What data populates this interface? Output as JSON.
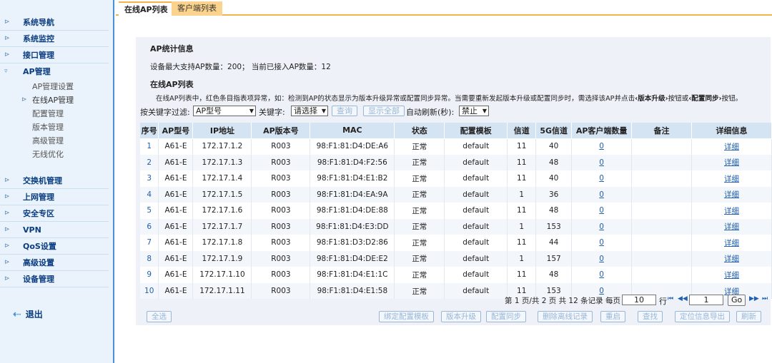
{
  "sidebar": {
    "sections_top": [
      {
        "label": "系统导航"
      },
      {
        "label": "系统监控"
      },
      {
        "label": "接口管理"
      }
    ],
    "ap_section": {
      "label": "AP管理"
    },
    "ap_subitems": [
      {
        "label": "AP管理设置"
      },
      {
        "label": "在线AP管理"
      },
      {
        "label": "配置管理"
      },
      {
        "label": "版本管理"
      },
      {
        "label": "高级管理"
      },
      {
        "label": "无线优化"
      }
    ],
    "sections_bottom": [
      {
        "label": "交换机管理"
      },
      {
        "label": "上网管理"
      },
      {
        "label": "安全专区"
      },
      {
        "label": "VPN"
      },
      {
        "label": "QoS设置"
      },
      {
        "label": "高级设置"
      },
      {
        "label": "设备管理"
      }
    ],
    "logout": "退出"
  },
  "tabs": {
    "online_ap": "在线AP列表",
    "client": "客户端列表"
  },
  "stats": {
    "title": "AP统计信息",
    "text": "设备最大支持AP数量：200； 当前已接入AP数量：12"
  },
  "list": {
    "title": "在线AP列表",
    "note_prefix": "在线AP列表中，红色条目指表项异常，如：检测到AP的状态显示为版本升级异常或配置同步异常。当需要重新发起版本升级或配置同步时，需选择该AP并点击",
    "note_upgrade": "‹版本升级›",
    "note_mid": "按钮或",
    "note_sync": "‹配置同步›",
    "note_suffix": "按钮。"
  },
  "filter": {
    "label": "按关键字过滤:",
    "field_value": "AP型号",
    "keyword_label": "关键字:",
    "keyword_value": "请选择",
    "query_btn": "查询",
    "show_all_btn": "显示全部",
    "auto_refresh_label": "自动刷新(秒):",
    "auto_refresh_value": "禁止"
  },
  "table": {
    "headers": [
      "序号",
      "AP型号",
      "IP地址",
      "AP版本号",
      "MAC",
      "状态",
      "配置模板",
      "信道",
      "5G信道",
      "AP客户端数量",
      "备注",
      "详细信息"
    ],
    "rows": [
      [
        "1",
        "A61-E",
        "172.17.1.2",
        "R003",
        "98:F1:81:D4:DE:A6",
        "正常",
        "default",
        "11",
        "40",
        "0",
        "",
        "详细"
      ],
      [
        "2",
        "A61-E",
        "172.17.1.3",
        "R003",
        "98:F1:81:D4:F2:56",
        "正常",
        "default",
        "11",
        "48",
        "0",
        "",
        "详细"
      ],
      [
        "3",
        "A61-E",
        "172.17.1.4",
        "R003",
        "98:F1:81:D4:E1:B2",
        "正常",
        "default",
        "11",
        "40",
        "0",
        "",
        "详细"
      ],
      [
        "4",
        "A61-E",
        "172.17.1.5",
        "R003",
        "98:F1:81:D4:EA:9A",
        "正常",
        "default",
        "1",
        "36",
        "0",
        "",
        "详细"
      ],
      [
        "5",
        "A61-E",
        "172.17.1.6",
        "R003",
        "98:F1:81:D4:DE:88",
        "正常",
        "default",
        "11",
        "48",
        "0",
        "",
        "详细"
      ],
      [
        "6",
        "A61-E",
        "172.17.1.7",
        "R003",
        "98:F1:81:D4:E3:DD",
        "正常",
        "default",
        "1",
        "153",
        "0",
        "",
        "详细"
      ],
      [
        "7",
        "A61-E",
        "172.17.1.8",
        "R003",
        "98:F1:81:D3:D2:86",
        "正常",
        "default",
        "11",
        "44",
        "0",
        "",
        "详细"
      ],
      [
        "8",
        "A61-E",
        "172.17.1.9",
        "R003",
        "98:F1:81:D4:DE:E2",
        "正常",
        "default",
        "1",
        "157",
        "0",
        "",
        "详细"
      ],
      [
        "9",
        "A61-E",
        "172.17.1.10",
        "R003",
        "98:F1:81:D4:E1:1C",
        "正常",
        "default",
        "11",
        "48",
        "0",
        "",
        "详细"
      ],
      [
        "10",
        "A61-E",
        "172.17.1.11",
        "R003",
        "98:F1:81:D4:E1:58",
        "正常",
        "default",
        "11",
        "153",
        "0",
        "",
        "详细"
      ]
    ]
  },
  "pager": {
    "info": "第 1 页/共 2 页 共 12 条记录 每页",
    "per_page": "10",
    "row_label": "行",
    "page_value": "1",
    "go": "Go"
  },
  "actions": {
    "select_all": "全选",
    "bind_template": "绑定配置模板",
    "upgrade": "版本升级",
    "sync": "配置同步",
    "delete_offline": "删除离线记录",
    "restart": "重启",
    "find": "查找",
    "export_location": "定位信息导出",
    "refresh": "刷新"
  }
}
